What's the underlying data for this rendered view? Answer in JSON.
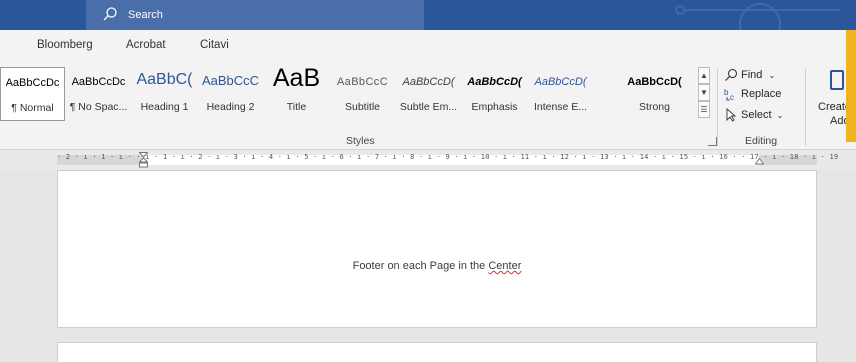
{
  "titlebar": {
    "search_label": "Search"
  },
  "tabs": [
    {
      "label": "Bloomberg"
    },
    {
      "label": "Acrobat"
    },
    {
      "label": "Citavi"
    }
  ],
  "styles_gallery": {
    "group_label": "Styles",
    "items": [
      {
        "sample": "AaBbCcDc",
        "name": "¶ Normal"
      },
      {
        "sample": "AaBbCcDc",
        "name": "¶ No Spac..."
      },
      {
        "sample": "AaBbC(",
        "name": "Heading 1"
      },
      {
        "sample": "AaBbCcC",
        "name": "Heading 2"
      },
      {
        "sample": "AaB",
        "name": "Title"
      },
      {
        "sample": "AaBbCcC",
        "name": "Subtitle"
      },
      {
        "sample": "AaBbCcD(",
        "name": "Subtle Em..."
      },
      {
        "sample": "AaBbCcD(",
        "name": "Emphasis"
      },
      {
        "sample": "AaBbCcD(",
        "name": "Intense E..."
      },
      {
        "sample": "AaBbCcD(",
        "name": "Strong"
      }
    ]
  },
  "editing": {
    "group_label": "Editing",
    "find": "Find",
    "replace": "Replace",
    "select": "Select"
  },
  "adobe": {
    "line1": "Create a",
    "line2": "Adol"
  },
  "ruler": {
    "text": "· 2 · ı · 1 · ı ·   · ı · 1 · ı · 2 · ı · 3 · ı · 4 · ı · 5 · ı · 6 · ı · 7 · ı · 8 · ı · 9 · ı · 10 · ı · 11 · ı · 12 · ı · 13 · ı · 14 · ı · 15 · ı · 16 ·   · 17 · ı · 18 · ı · 19"
  },
  "document": {
    "footer_prefix": "Footer on each Page in the ",
    "footer_word": "Center"
  },
  "colors": {
    "titlebar": "#2b579a",
    "accent": "#f3b31e",
    "heading_blue": "#2f5597"
  }
}
